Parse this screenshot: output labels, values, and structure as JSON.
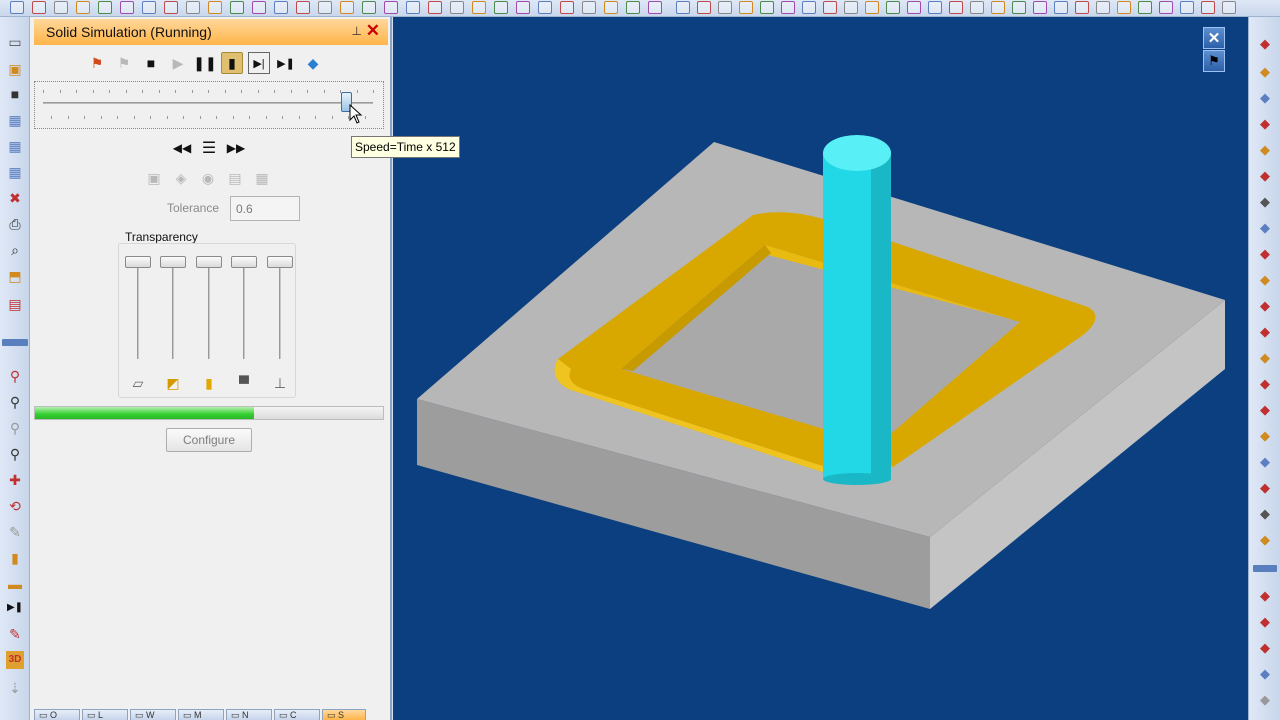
{
  "panel": {
    "title": "Solid Simulation (Running)",
    "pin_icon": "pin-icon",
    "close_icon": "close-icon"
  },
  "sim_controls": [
    {
      "name": "tool-path-icon",
      "state": "enabled"
    },
    {
      "name": "multi-step-icon",
      "state": "disabled"
    },
    {
      "name": "stop-icon",
      "state": "enabled"
    },
    {
      "name": "play-icon",
      "state": "disabled"
    },
    {
      "name": "pause-icon",
      "state": "enabled"
    },
    {
      "name": "tool-display-icon",
      "state": "pressed"
    },
    {
      "name": "step-display-icon",
      "state": "enabled"
    },
    {
      "name": "step-to-next-icon",
      "state": "enabled"
    },
    {
      "name": "color-icon",
      "state": "enabled"
    }
  ],
  "speed": {
    "tooltip": "Speed=Time x 512",
    "level": 0.92
  },
  "playback": [
    "rewind-icon",
    "stop-square-icon",
    "fast-forward-icon"
  ],
  "snapshot_icons": [
    "snapshot-icon",
    "compare-icon",
    "compare-solid-icon",
    "save-stock-icon",
    "stock-grid-icon"
  ],
  "tolerance": {
    "label": "Tolerance",
    "value": "0.6"
  },
  "transparency": {
    "label": "Transparency",
    "sliders": [
      {
        "name": "stock-transparency-slider",
        "icon": "stock-icon",
        "level": 0
      },
      {
        "name": "fixture-transparency-slider",
        "icon": "fixture-icon",
        "level": 0
      },
      {
        "name": "tool-transparency-slider",
        "icon": "tool-icon",
        "level": 0
      },
      {
        "name": "holder-transparency-slider",
        "icon": "holder-icon",
        "level": 0
      },
      {
        "name": "arbor-transparency-slider",
        "icon": "arbor-icon",
        "level": 0
      }
    ]
  },
  "progress": {
    "fraction": 0.63
  },
  "configure_label": "Configure",
  "bottom_tabs": [
    {
      "label": "O"
    },
    {
      "label": "L"
    },
    {
      "label": "W"
    },
    {
      "label": "M"
    },
    {
      "label": "N"
    },
    {
      "label": "C"
    },
    {
      "label": "S",
      "active": true
    }
  ],
  "viewport": {
    "background": "#0b3f80",
    "close_icon": "viewport-close-icon",
    "tool_icon": "simulation-tool-icon",
    "colors": {
      "stock_top": "#b7b7b7",
      "stock_side_front": "#9d9d9d",
      "stock_side_right": "#c4c4c4",
      "pocket": "#e3b100",
      "tool": "#33e6f0"
    }
  },
  "colors": {
    "title_bar": "#ffb54a",
    "toolbar": "#dfe8f6",
    "progress": "#35d030"
  }
}
